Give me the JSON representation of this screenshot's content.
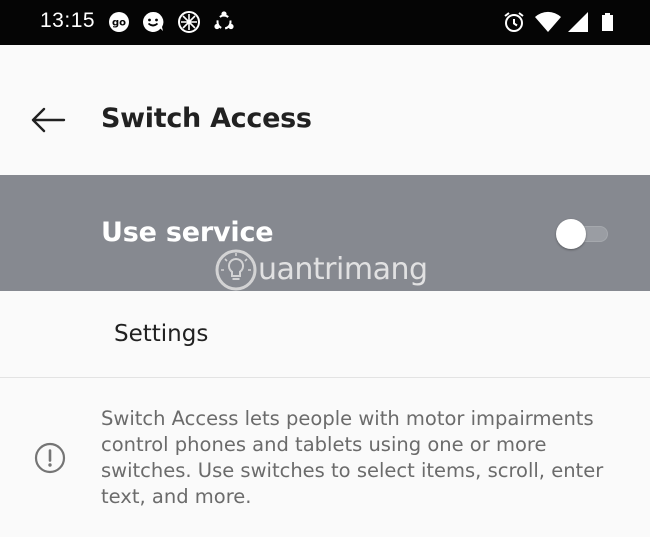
{
  "status_bar": {
    "time": "13:15",
    "notification_icons": [
      "go-icon",
      "smiley-icon",
      "gallery-icon",
      "recycle-icon"
    ],
    "system_icons": [
      "alarm-icon",
      "wifi-icon",
      "signal-icon",
      "battery-icon"
    ]
  },
  "header": {
    "back_icon": "arrow-left-icon",
    "title": "Switch Access"
  },
  "service": {
    "label": "Use service",
    "toggle_on": false
  },
  "watermark": {
    "text": "uantrimang"
  },
  "settings": {
    "label": "Settings"
  },
  "description": {
    "icon": "info-icon",
    "text": "Switch Access lets people with motor impairments control phones and tablets using one or more switches. Use switches to select items, scroll, enter text, and more."
  },
  "colors": {
    "status_bar_bg": "#050505",
    "page_bg": "#fafafa",
    "service_row_bg": "#868990",
    "secondary_text": "#6b6b6b"
  }
}
